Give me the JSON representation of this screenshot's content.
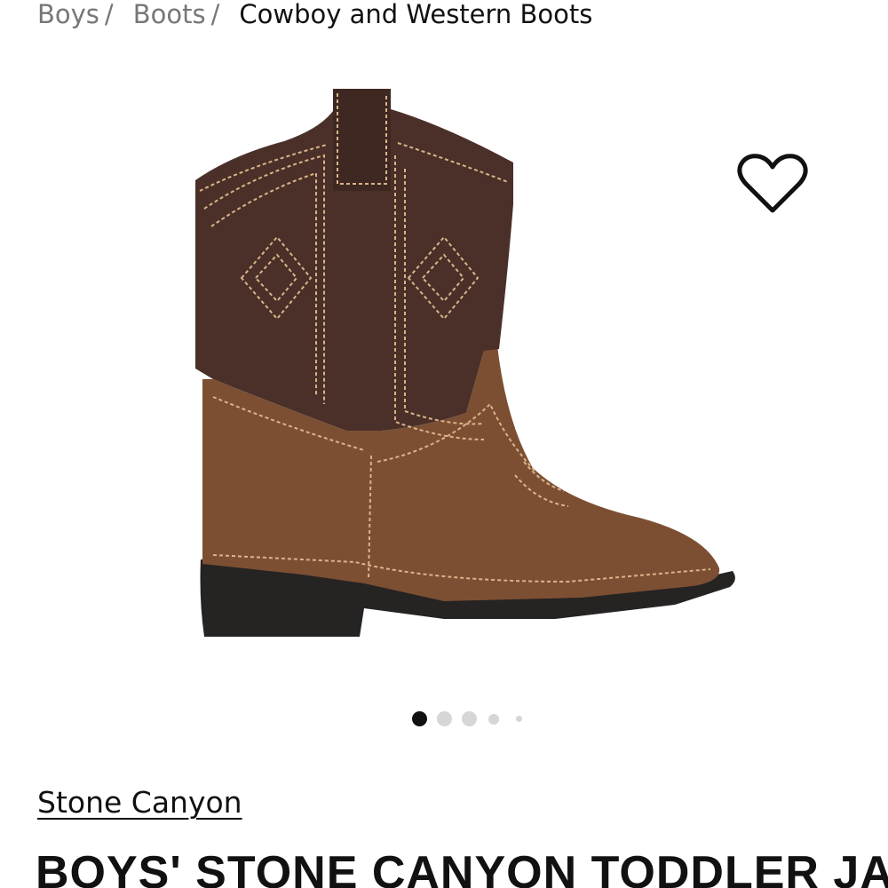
{
  "breadcrumb": {
    "items": [
      "Boys",
      "Boots"
    ],
    "separator": "/",
    "current": "Cowboy and Western Boots"
  },
  "gallery": {
    "image_alt": "Boys' Stone Canyon Toddler Jared cowboy boot",
    "favorite_icon": "heart-outline-icon",
    "dot_count": 5,
    "active_index": 0
  },
  "product": {
    "brand": "Stone Canyon",
    "title": "BOYS' STONE CANYON TODDLER JARED"
  },
  "colors": {
    "text": "#111111",
    "muted": "#777777",
    "boot_shaft": "#4a3028",
    "boot_foot": "#7c4f33",
    "stitching": "#d9b48a",
    "sole": "#262323"
  }
}
